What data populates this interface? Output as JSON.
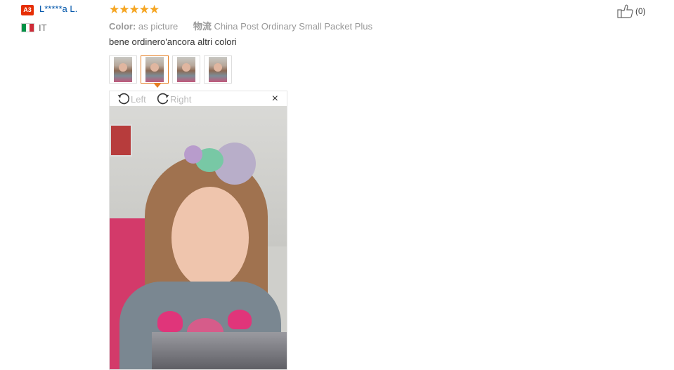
{
  "reviewer": {
    "level_badge": "A3",
    "name": "L*****a L.",
    "country": "IT",
    "flag_colors": [
      "#009246",
      "#ffffff",
      "#ce2b37"
    ]
  },
  "review": {
    "stars": "★★★★★",
    "rating": 5,
    "color_label": "Color:",
    "color_value": "as picture",
    "shipping_label": "物流",
    "shipping_value": "China Post Ordinary Small Packet Plus",
    "comment": "bene ordinero'ancora altri colori",
    "thumbnails": [
      "photo 1",
      "photo 2",
      "photo 3",
      "photo 4"
    ],
    "active_thumbnail": 1
  },
  "viewer": {
    "rotate_left_label": "Left",
    "rotate_right_label": "Right",
    "close_glyph": "×"
  },
  "helpful": {
    "count": "(0)"
  },
  "colors": {
    "accent": "#e67e22",
    "link": "#0055aa",
    "star": "#f5a623",
    "badge": "#e62e04"
  }
}
